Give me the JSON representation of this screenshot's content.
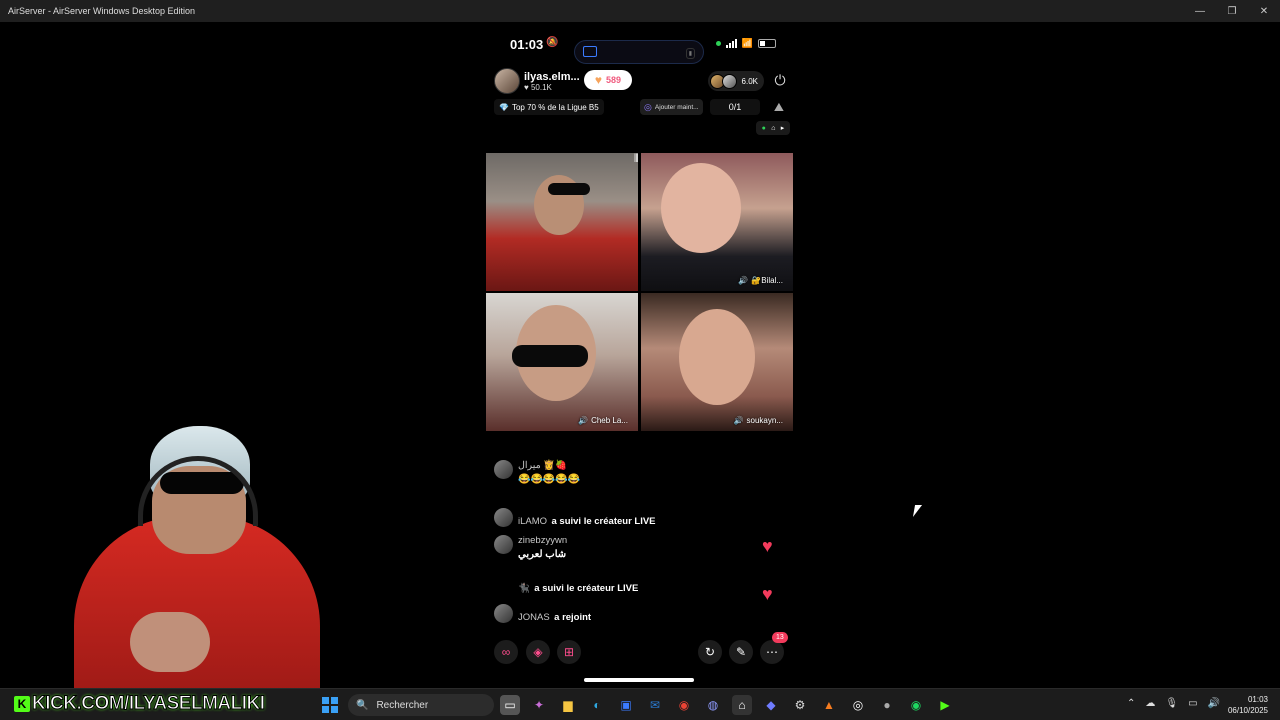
{
  "window": {
    "title": "AirServer - AirServer Windows Desktop Edition",
    "controls": [
      "—",
      "❐",
      "✕"
    ]
  },
  "phone": {
    "status": {
      "time": "01:03"
    },
    "host": {
      "name": "ilyas.elm...",
      "likes": "50.1K"
    },
    "gift_count": "589",
    "viewer_count": "6.0K",
    "league": "Top 70 % de la Ligue B5",
    "add_button": "Ajouter maint...",
    "counter": "0/1",
    "participants": [
      {
        "name": ""
      },
      {
        "name": "🔐Bilal..."
      },
      {
        "name": "Cheb La..."
      },
      {
        "name": "soukayn..."
      }
    ],
    "chat": [
      {
        "user": "ميرال 👸🍓",
        "text": "😂😂😂😂😂"
      },
      {
        "user": "iLAMO",
        "text": "a suivi le créateur LIVE"
      },
      {
        "user": "zinebzyywn",
        "text": "شاب لعربي"
      },
      {
        "user": "🐈‍⬛",
        "text": "a suivi le créateur LIVE"
      },
      {
        "user": "JONAS",
        "text": "a rejoint"
      }
    ],
    "more_badge": "13",
    "colors": {
      "accent": "#f23b5c",
      "gift": "#f7a45c"
    }
  },
  "overlay": {
    "kick_text": "KICK.COM/ILYASELMALIKI"
  },
  "taskbar": {
    "search_placeholder": "Rechercher",
    "time": "01:03",
    "date": "06/10/2025"
  }
}
